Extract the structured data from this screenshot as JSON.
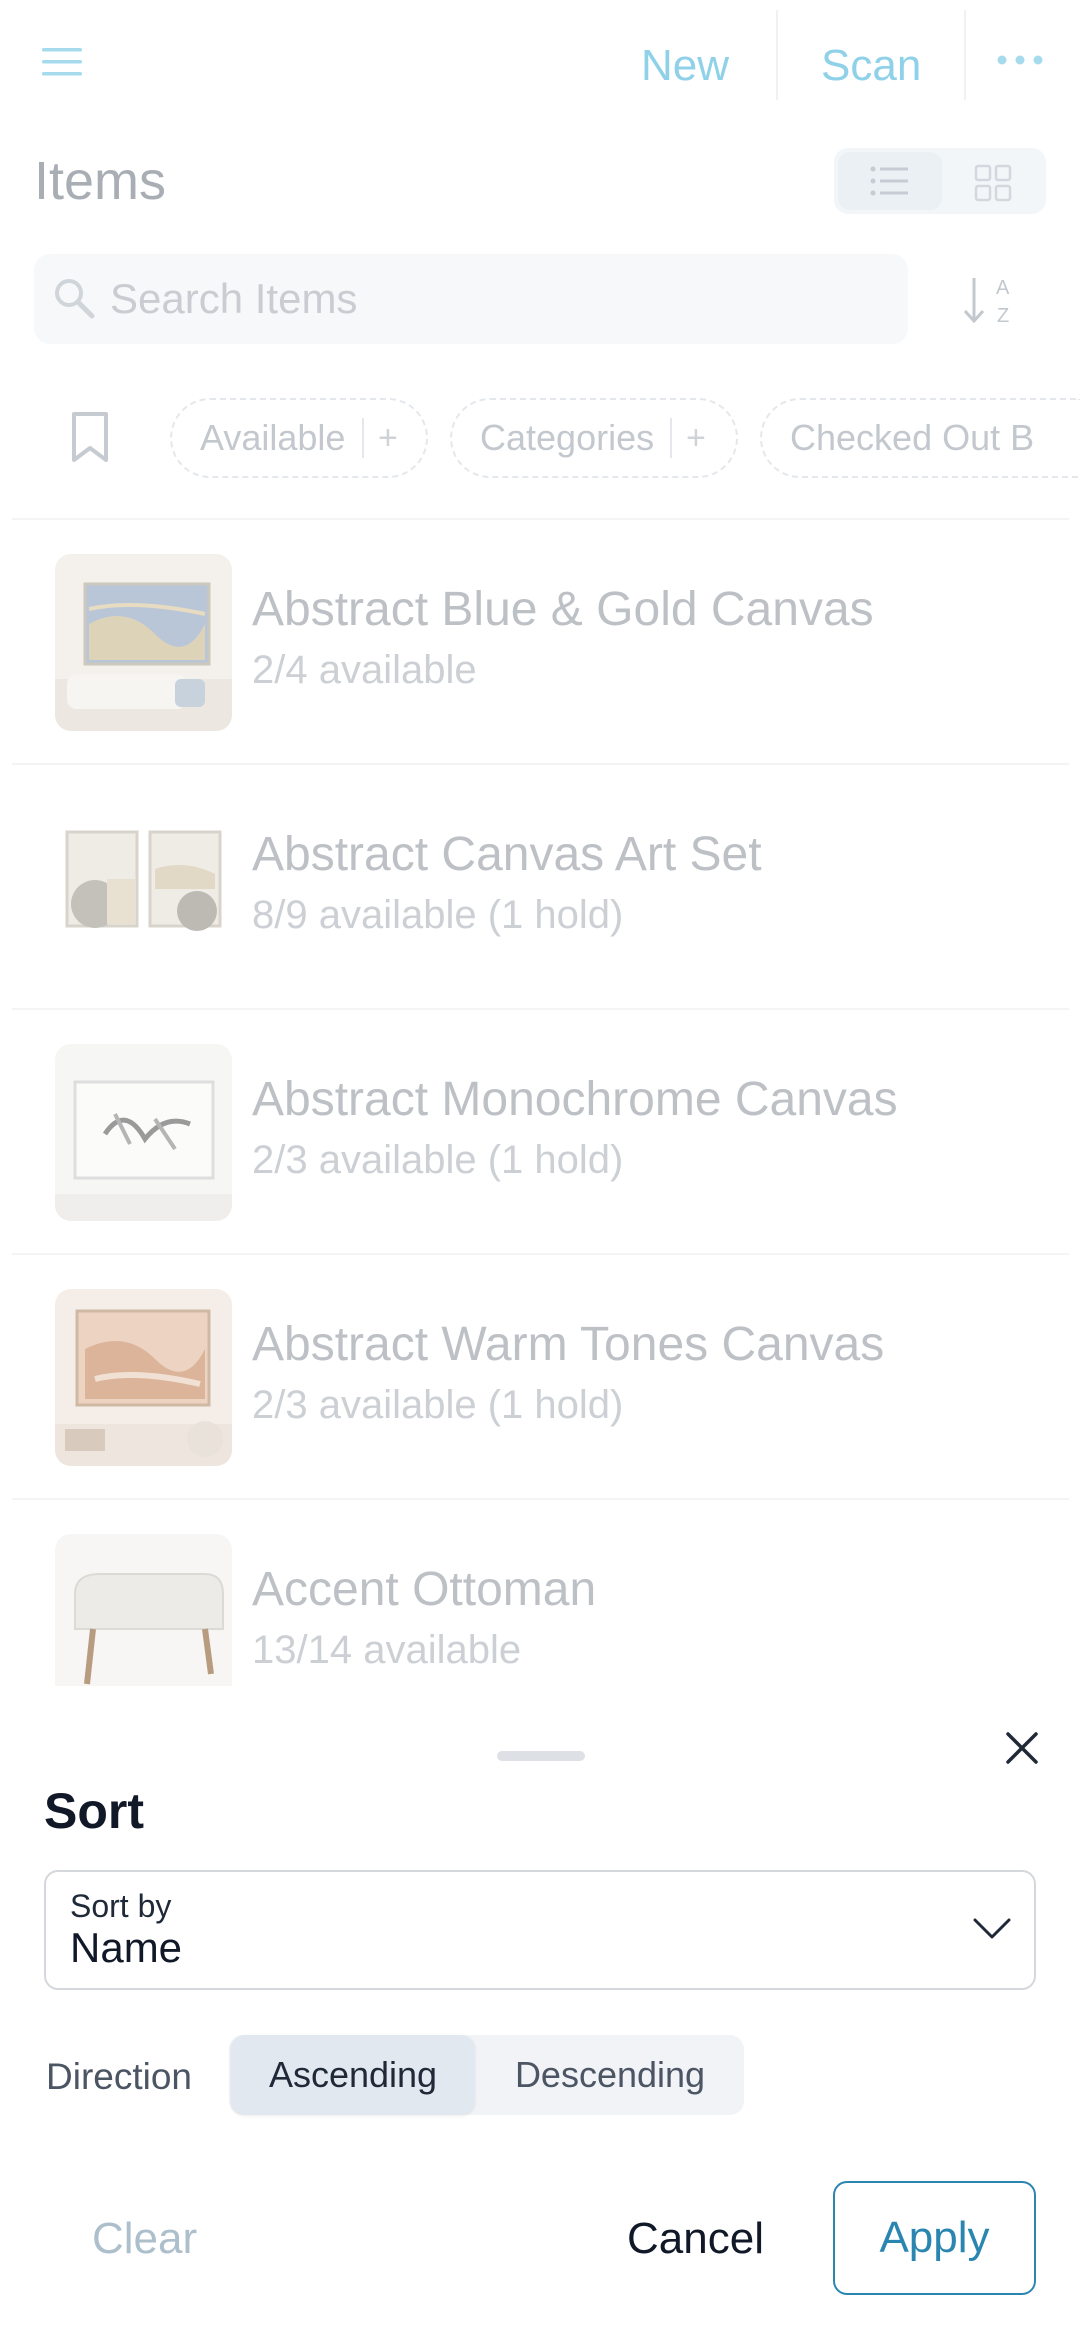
{
  "header": {
    "new_label": "New",
    "scan_label": "Scan"
  },
  "page": {
    "title": "Items"
  },
  "search": {
    "placeholder": "Search Items",
    "value": ""
  },
  "filters": [
    {
      "label": "Available"
    },
    {
      "label": "Categories"
    },
    {
      "label": "Checked Out B"
    }
  ],
  "items": [
    {
      "name": "Abstract Blue & Gold Canvas",
      "availability": "2/4 available"
    },
    {
      "name": "Abstract Canvas Art Set",
      "availability": "8/9 available (1 hold)"
    },
    {
      "name": "Abstract Monochrome Canvas",
      "availability": "2/3 available (1 hold)"
    },
    {
      "name": "Abstract Warm Tones Canvas",
      "availability": "2/3 available (1 hold)"
    },
    {
      "name": "Accent Ottoman",
      "availability": "13/14 available"
    }
  ],
  "sort_sheet": {
    "title": "Sort",
    "sort_by_label": "Sort by",
    "sort_by_value": "Name",
    "direction_label": "Direction",
    "direction_options": [
      "Ascending",
      "Descending"
    ],
    "direction_selected": "Ascending",
    "clear_label": "Clear",
    "cancel_label": "Cancel",
    "apply_label": "Apply"
  },
  "colors": {
    "accent": "#2a86b0",
    "header_accent_faded": "#8fd1e8",
    "title_text": "#111827"
  },
  "icons": [
    "menu-icon",
    "more-icon",
    "list-view-icon",
    "grid-view-icon",
    "search-icon",
    "sort-az-icon",
    "bookmark-icon",
    "close-icon",
    "chevron-down-icon"
  ]
}
